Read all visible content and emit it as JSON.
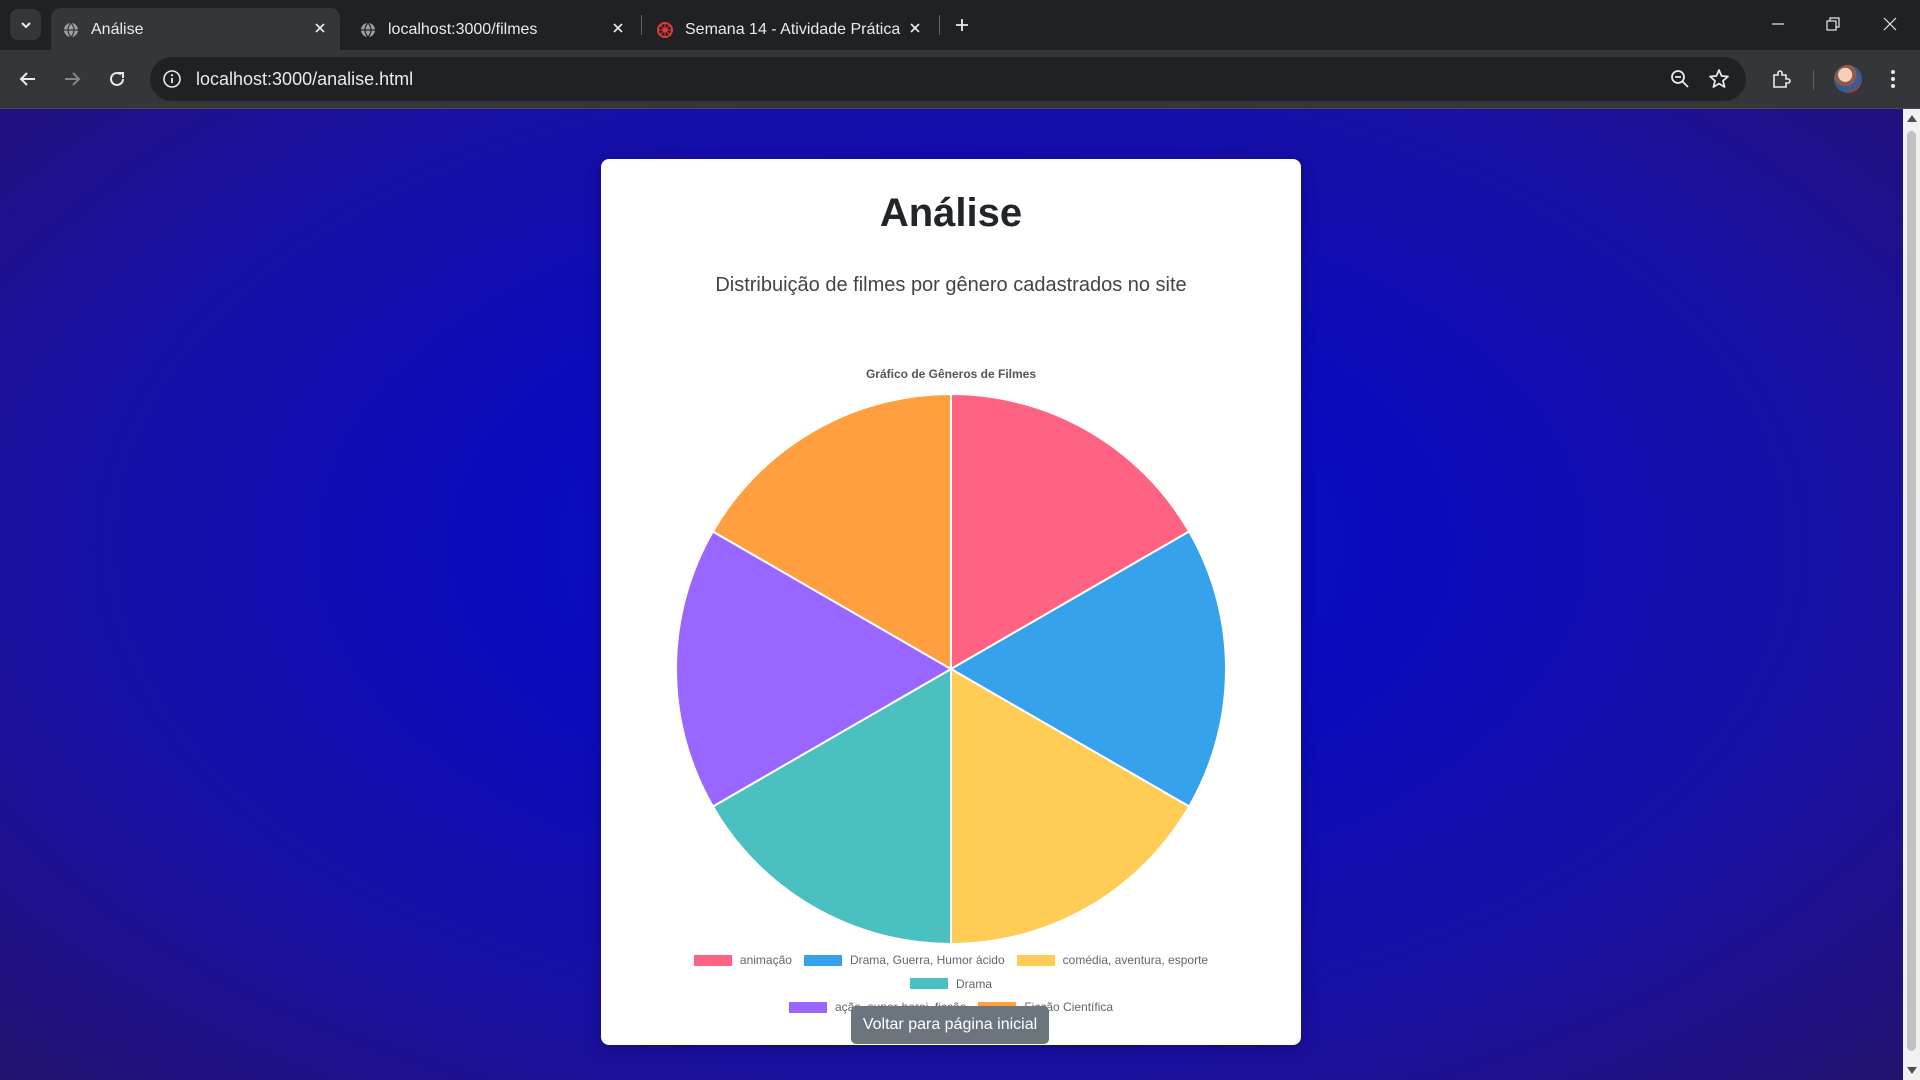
{
  "browser": {
    "tabs": [
      {
        "title": "Análise",
        "active": true,
        "icon": "globe-icon"
      },
      {
        "title": "localhost:3000/filmes",
        "active": false,
        "icon": "globe-icon"
      },
      {
        "title": "Semana 14 - Atividade Prática",
        "active": false,
        "icon": "puc-logo-icon"
      }
    ],
    "url": "localhost:3000/analise.html"
  },
  "page": {
    "heading": "Análise",
    "subtitle": "Distribuição de filmes por gênero cadastrados no site",
    "back_button": "Voltar para página inicial"
  },
  "chart_data": {
    "type": "pie",
    "title": "Gráfico de Gêneros de Filmes",
    "categories": [
      "animação",
      "Drama, Guerra, Humor ácido",
      "comédia, aventura, esporte",
      "Drama",
      "ação, super-heroi, ficção",
      "Ficção Científica"
    ],
    "values": [
      1,
      1,
      1,
      1,
      1,
      1
    ],
    "colors": [
      "#ff6384",
      "#36a2eb",
      "#ffcd56",
      "#4bc0c0",
      "#9966ff",
      "#ff9f40"
    ],
    "legend": "bottom"
  }
}
